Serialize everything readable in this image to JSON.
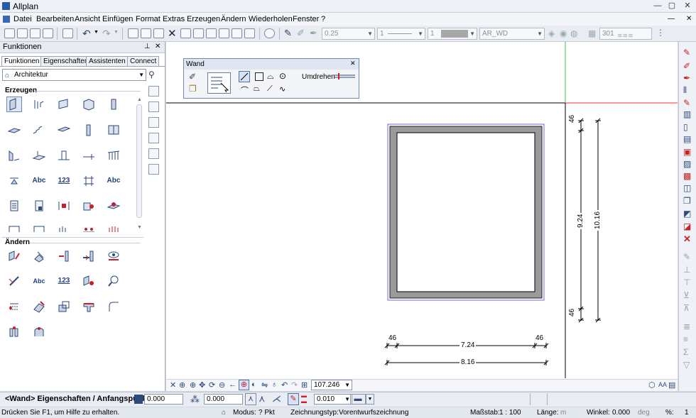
{
  "app": {
    "title": "Allplan"
  },
  "menu": [
    "Datei",
    "Bearbeiten",
    "Ansicht",
    "Einfügen",
    "Format",
    "Extras",
    "Erzeugen",
    "Ändern",
    "Wiederholen",
    "Fenster",
    "?"
  ],
  "toolbar": {
    "pen_value": "0.25",
    "line_value": "1",
    "color_value": "1",
    "layer_value": "AR_WD",
    "hatch_value": "301"
  },
  "left_panel": {
    "title": "Funktionen",
    "tabs": [
      "Funktionen",
      "Eigenschaften",
      "Assistenten",
      "Connect"
    ],
    "module": "Architektur",
    "sections": {
      "create": "Erzeugen",
      "modify": "Ändern"
    },
    "text_icons": {
      "abc1": "Abc",
      "num123": "123",
      "abc2": "Abc",
      "abc3": "Abc",
      "num123b": "123"
    }
  },
  "wand_palette": {
    "title": "Wand",
    "umdrehen_label": "Umdrehen"
  },
  "drawing": {
    "dims": {
      "top_left": "46",
      "bottom_left": "46",
      "h_inner": "7.24",
      "h_outer": "8.16",
      "v_top": "46",
      "v_bottom": "46",
      "v_inner": "9.24",
      "v_outer": "10.16"
    }
  },
  "zoombar": {
    "zoom_value": "107.246"
  },
  "dialog": {
    "prompt": "<Wand> Eigenschaften / Anfangspunkt",
    "value1": "0.000",
    "value2": "0.000",
    "value3": "0.010"
  },
  "status": {
    "help": "Drücken Sie F1, um Hilfe zu erhalten.",
    "mode_label": "Modus:",
    "mode_value": "? Pkt",
    "drawtype_label": "Zeichnungstyp:",
    "drawtype_value": "Vorentwurfszeichnung",
    "scale_label": "Maßstab:",
    "scale_value": "1 : 100",
    "length_label": "Länge:",
    "length_unit": "m",
    "angle_label": "Winkel:",
    "angle_value": "0.000",
    "angle_unit": "deg",
    "percent_label": "%:",
    "percent_value": "1"
  },
  "colors": {
    "accent": "#2a5aa8",
    "wall_fill": "#9a9a9a",
    "axis_red": "#ff3030",
    "axis_green": "#35c435"
  }
}
